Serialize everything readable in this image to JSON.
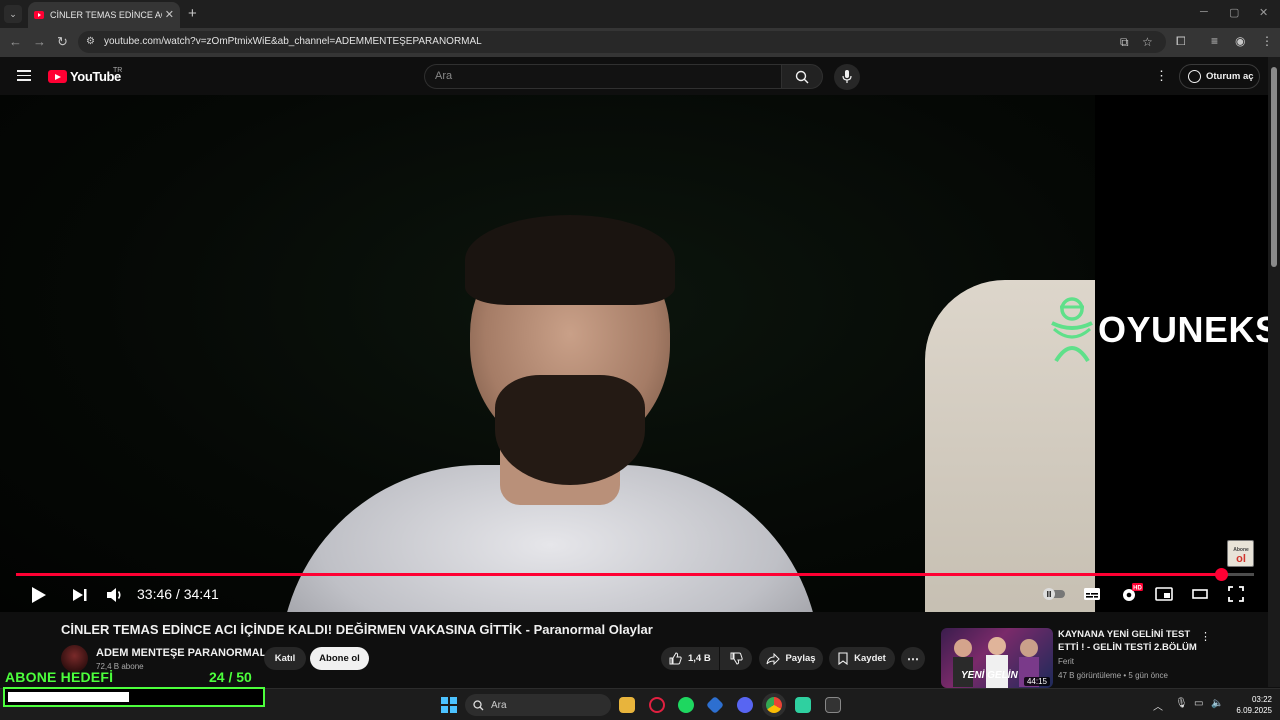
{
  "browser": {
    "tab_title": "CİNLER TEMAS EDİNCE ACI İÇİNDE KALDI!",
    "url": "youtube.com/watch?v=zOmPtmixWiE&ab_channel=ADEMMENTEŞEPARANORMAL"
  },
  "header": {
    "logo_text": "YouTube",
    "country": "TR",
    "search_placeholder": "Ara",
    "signin_label": "Oturum aç"
  },
  "player": {
    "watermark": "OYUNEKS",
    "sticker": "Abone ol",
    "time_display": "33:46 / 34:41",
    "progress": 0.973
  },
  "video": {
    "title": "CİNLER TEMAS EDİNCE ACI İÇİNDE KALDI! DEĞİRMEN VAKASINA GİTTİK - Paranormal Olaylar",
    "channel_name": "ADEM MENTEŞE PARANORMAL",
    "subscribers": "72,4 B abone",
    "join_label": "Katıl",
    "subscribe_label": "Abone ol",
    "like_count": "1,4 B",
    "share_label": "Paylaş",
    "save_label": "Kaydet"
  },
  "suggestion": {
    "title": "KAYNANA YENİ GELİNİ TEST ETTİ ! - GELİN TESTİ 2.BÖLÜM",
    "channel": "Ferit",
    "meta": "47 B görüntüleme • 5 gün önce",
    "duration": "44:15",
    "thumb_text": "YENİ GELİN"
  },
  "overlay": {
    "goal_label": "ABONE HEDEFİ",
    "goal_count": "24  / 50",
    "goal_current": 24,
    "goal_target": 50
  },
  "taskbar": {
    "search_label": "Ara",
    "time": "03:22",
    "date": "6.09.2025"
  }
}
